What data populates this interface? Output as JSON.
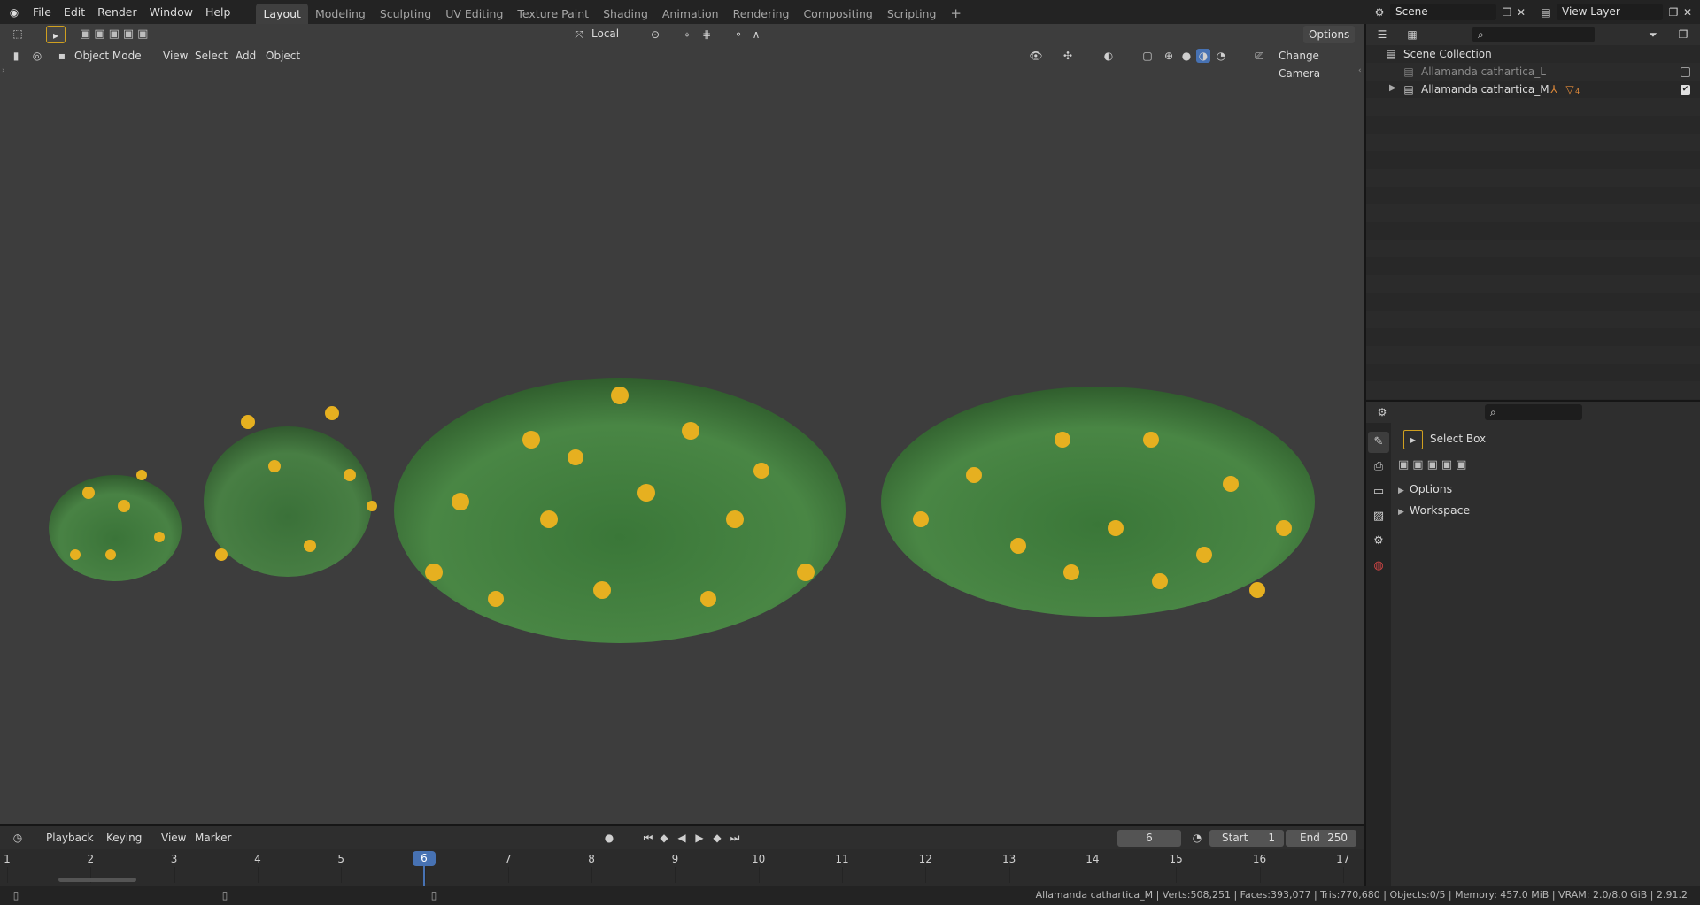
{
  "topbar": {
    "menus": [
      "File",
      "Edit",
      "Render",
      "Window",
      "Help"
    ],
    "workspace_tabs": [
      "Layout",
      "Modeling",
      "Sculpting",
      "UV Editing",
      "Texture Paint",
      "Shading",
      "Animation",
      "Rendering",
      "Compositing",
      "Scripting"
    ],
    "active_tab": "Layout",
    "add_tab": "+",
    "scene_label": "Scene",
    "view_layer_label": "View Layer"
  },
  "viewport": {
    "transform_orientation": "Local",
    "options_label": "Options",
    "mode_label": "Object Mode",
    "menu_view": "View",
    "menu_select": "Select",
    "menu_add": "Add",
    "menu_object": "Object",
    "change_camera": "Change Camera",
    "colors": {
      "background": "#3d3d3d",
      "leaf": "#3f7a3a",
      "flower": "#e6b020"
    }
  },
  "outliner": {
    "root": "Scene Collection",
    "items": [
      {
        "name": "Allamanda cathartica_L",
        "enabled": false
      },
      {
        "name": "Allamanda cathartica_M",
        "enabled": true,
        "badge": "4"
      }
    ]
  },
  "properties": {
    "tool_name": "Select Box",
    "panels": [
      "Options",
      "Workspace"
    ]
  },
  "timeline": {
    "menus": [
      "Playback",
      "Keying",
      "View",
      "Marker"
    ],
    "current_frame": "6",
    "start_label": "Start",
    "start_value": "1",
    "end_label": "End",
    "end_value": "250",
    "ticks": [
      "1",
      "2",
      "3",
      "4",
      "5",
      "6",
      "7",
      "8",
      "9",
      "10",
      "11",
      "12",
      "13",
      "14",
      "15",
      "16",
      "17"
    ]
  },
  "statusbar": {
    "info": "Allamanda cathartica_M | Verts:508,251 | Faces:393,077 | Tris:770,680 | Objects:0/5 | Memory: 457.0 MiB | VRAM: 2.0/8.0 GiB | 2.91.2"
  }
}
